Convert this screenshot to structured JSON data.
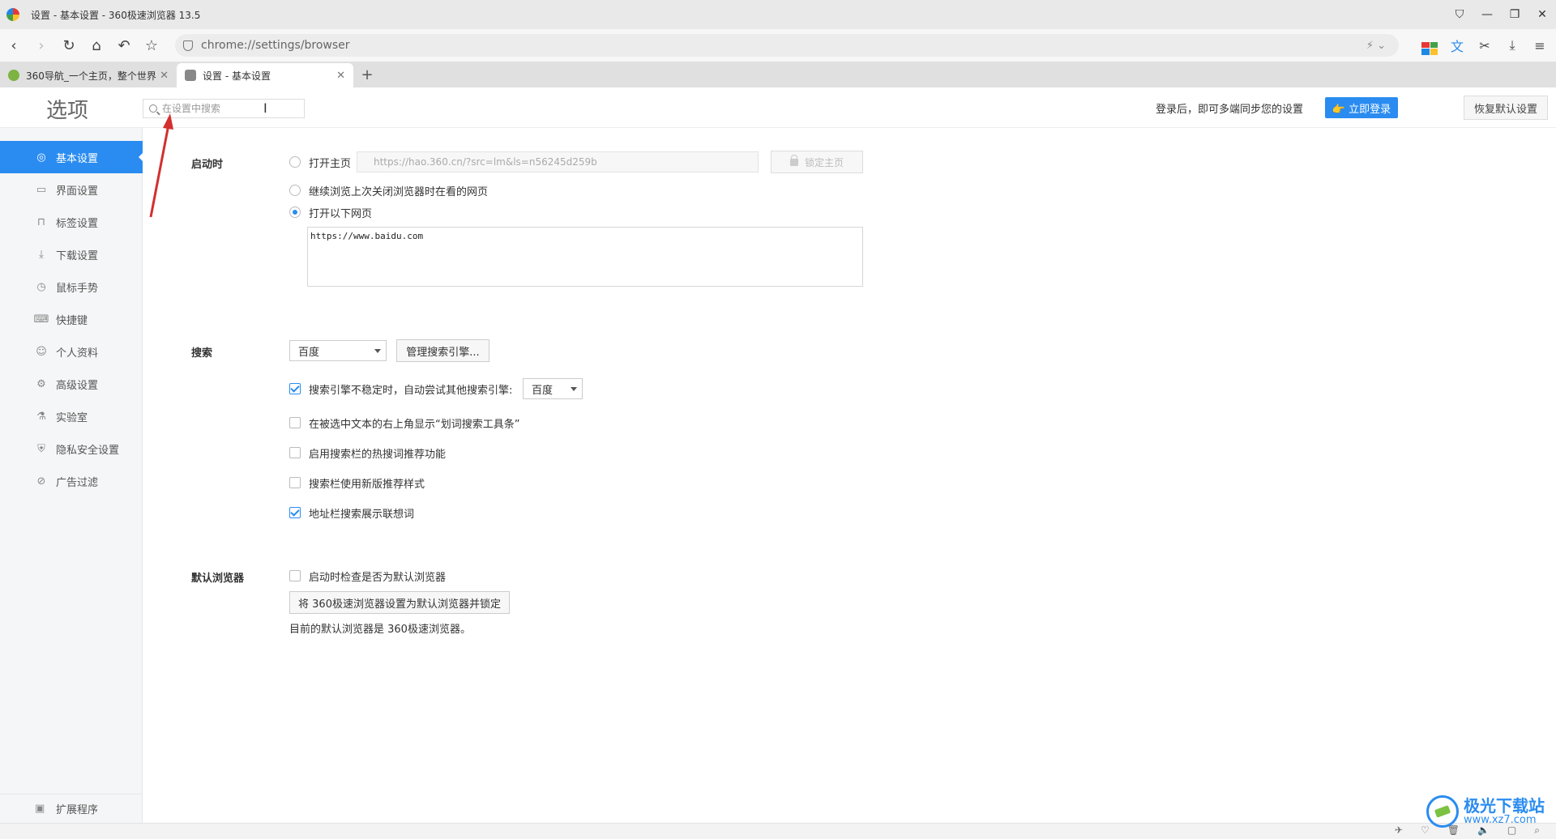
{
  "window": {
    "title": "设置 - 基本设置 - 360极速浏览器 13.5",
    "controls": [
      "⛉",
      "—",
      "❐",
      "✕"
    ]
  },
  "toolbar": {
    "url": "chrome://settings/browser",
    "tail": "⚡ ⌄"
  },
  "tabs": [
    {
      "label": "360导航_一个主页，整个世界",
      "close": "✕"
    },
    {
      "label": "设置 - 基本设置",
      "close": "✕"
    }
  ],
  "new_tab": "+",
  "header": {
    "title": "选项",
    "search_placeholder": "在设置中搜索",
    "sync_text": "登录后，即可多端同步您的设置",
    "login_button": "👉 立即登录",
    "restore_button": "恢复默认设置"
  },
  "sidebar": {
    "items": [
      {
        "label": "基本设置",
        "icon": "◎"
      },
      {
        "label": "界面设置",
        "icon": "▭"
      },
      {
        "label": "标签设置",
        "icon": "⊓"
      },
      {
        "label": "下载设置",
        "icon": "⤓"
      },
      {
        "label": "鼠标手势",
        "icon": "◷"
      },
      {
        "label": "快捷键",
        "icon": "⌨"
      },
      {
        "label": "个人资料",
        "icon": "☺"
      },
      {
        "label": "高级设置",
        "icon": "⚙"
      },
      {
        "label": "实验室",
        "icon": "⚗"
      },
      {
        "label": "隐私安全设置",
        "icon": "⛨"
      },
      {
        "label": "广告过滤",
        "icon": "⊘"
      }
    ],
    "extensions": {
      "label": "扩展程序",
      "icon": "▣"
    }
  },
  "startup": {
    "label": "启动时",
    "opt_home": "打开主页",
    "home_url": "https://hao.360.cn/?src=lm&ls=n56245d259b",
    "lock_home": "锁定主页",
    "opt_continue": "继续浏览上次关闭浏览器时在看的网页",
    "opt_pages": "打开以下网页",
    "pages_value": "https://www.baidu.com"
  },
  "search": {
    "label": "搜索",
    "engine": "百度",
    "manage_button": "管理搜索引擎...",
    "opt_fallback": "搜索引擎不稳定时，自动尝试其他搜索引擎:",
    "fallback_engine": "百度",
    "opt_toolbar": "在被选中文本的右上角显示“划词搜索工具条”",
    "opt_hotwords": "启用搜索栏的热搜词推荐功能",
    "opt_newstyle": "搜索栏使用新版推荐样式",
    "opt_suggest": "地址栏搜索展示联想词"
  },
  "default_browser": {
    "label": "默认浏览器",
    "opt_check": "启动时检查是否为默认浏览器",
    "set_button": "将 360极速浏览器设置为默认浏览器并锁定",
    "note": "目前的默认浏览器是 360极速浏览器。"
  },
  "watermark": {
    "line1": "极光下载站",
    "line2": "www.xz7.com"
  },
  "colors": {
    "accent": "#2a8cf0",
    "annotation_arrow": "#d32f2f"
  }
}
